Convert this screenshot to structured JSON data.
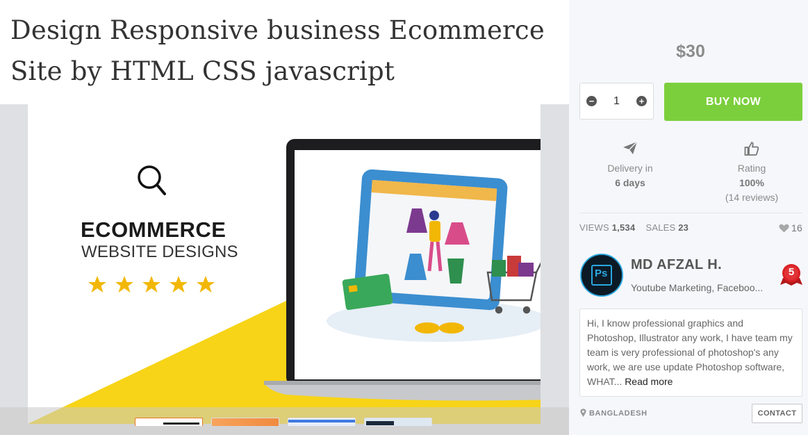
{
  "gig": {
    "title_line1": "Design Responsive business Ecommerce",
    "title_line2": "Site by HTML CSS javascript"
  },
  "hero_image": {
    "headline": "ECOMMERCE",
    "subheadline": "WEBSITE DESIGNS",
    "stars": 5,
    "icons": [
      "search-icon",
      "star-icon"
    ],
    "colors": {
      "accent_yellow": "#f7d417",
      "laptop_dark": "#222222",
      "screen_blue": "#3b8ed0"
    }
  },
  "thumbnails_count": 4,
  "order": {
    "price": "$30",
    "quantity": "1",
    "buy_label": "BUY NOW",
    "buy_color": "#7ccf3c"
  },
  "delivery": {
    "label": "Delivery in",
    "value": "6 days",
    "icon": "paper-plane-icon"
  },
  "rating": {
    "label": "Rating",
    "value": "100%",
    "reviews": "(14 reviews)",
    "icon": "thumbs-up-icon"
  },
  "stats": {
    "views_label": "VIEWS",
    "views_value": "1,534",
    "sales_label": "SALES",
    "sales_value": "23",
    "likes": "16"
  },
  "seller": {
    "name": "MD AFZAL H.",
    "tagline": "Youtube Marketing, Faceboo...",
    "avatar_text": "Ps",
    "level": "5",
    "bio": "Hi, I know professional graphics and Photoshop, Illustrator any work, I have team my team is very professional of photoshop's any work, we are use update Photoshop software, WHAT...",
    "read_more": "Read more",
    "country": "BANGLADESH",
    "contact_label": "CONTACT"
  }
}
